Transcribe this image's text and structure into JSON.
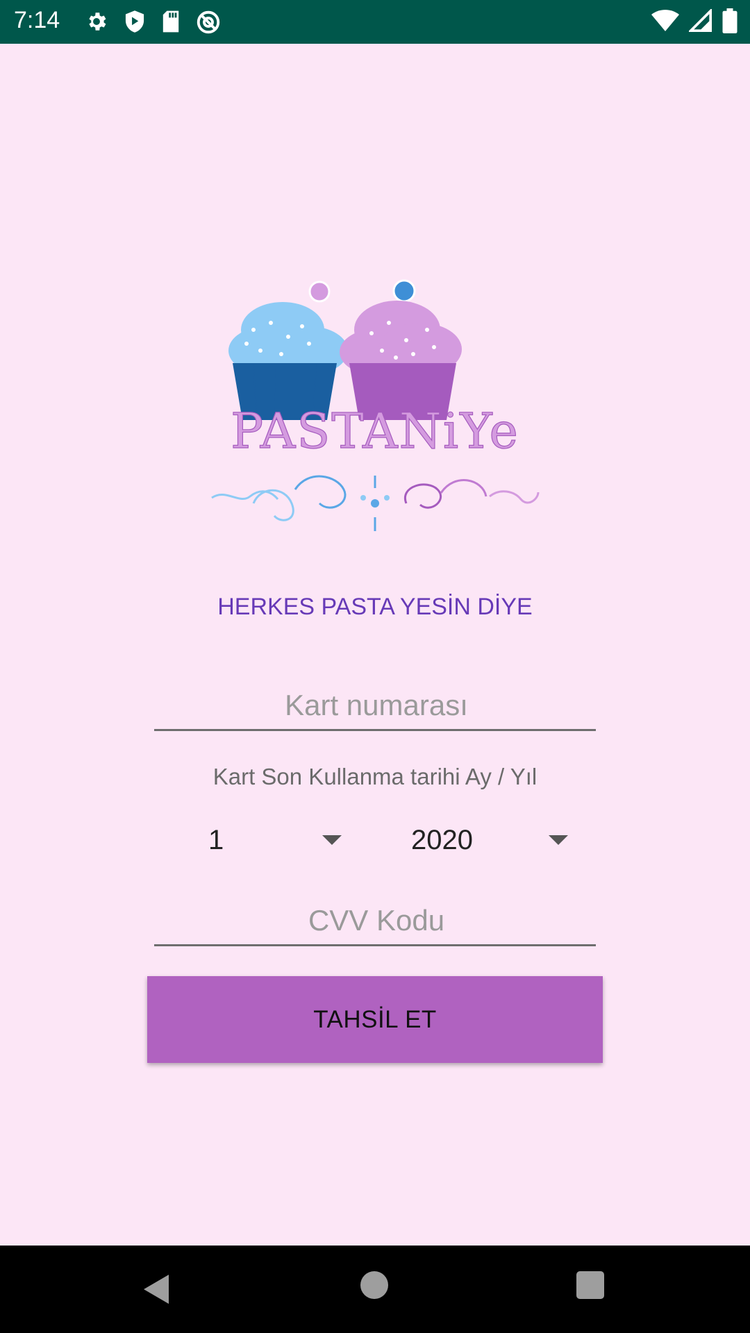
{
  "status_bar": {
    "time": "7:14",
    "left_icons": [
      "gear-icon",
      "shield-play-icon",
      "sd-card-icon",
      "at-sign-icon"
    ],
    "right_icons": [
      "wifi-icon",
      "cell-signal-icon",
      "battery-icon"
    ],
    "background": "#00574B"
  },
  "logo": {
    "brand_text": "PASTANiYe",
    "colors": {
      "blue": "#1A5FA0",
      "light_blue": "#8ECBF5",
      "purple": "#A55BBE",
      "lilac": "#D49BDF"
    }
  },
  "tagline": "HERKES PASTA YESİN DİYE",
  "form": {
    "card_number": {
      "placeholder": "Kart numarası",
      "value": ""
    },
    "expiry": {
      "label": "Kart Son Kullanma tarihi Ay / Yıl",
      "month": "1",
      "year": "2020"
    },
    "cvv": {
      "placeholder": "CVV Kodu",
      "value": ""
    },
    "submit_label": "TAHSİL ET"
  },
  "colors": {
    "background": "#FCE6F6",
    "tagline": "#673AB7",
    "button": "#B062C0"
  },
  "nav_bar": {
    "icons": [
      "back-icon",
      "home-icon",
      "recents-icon"
    ]
  }
}
